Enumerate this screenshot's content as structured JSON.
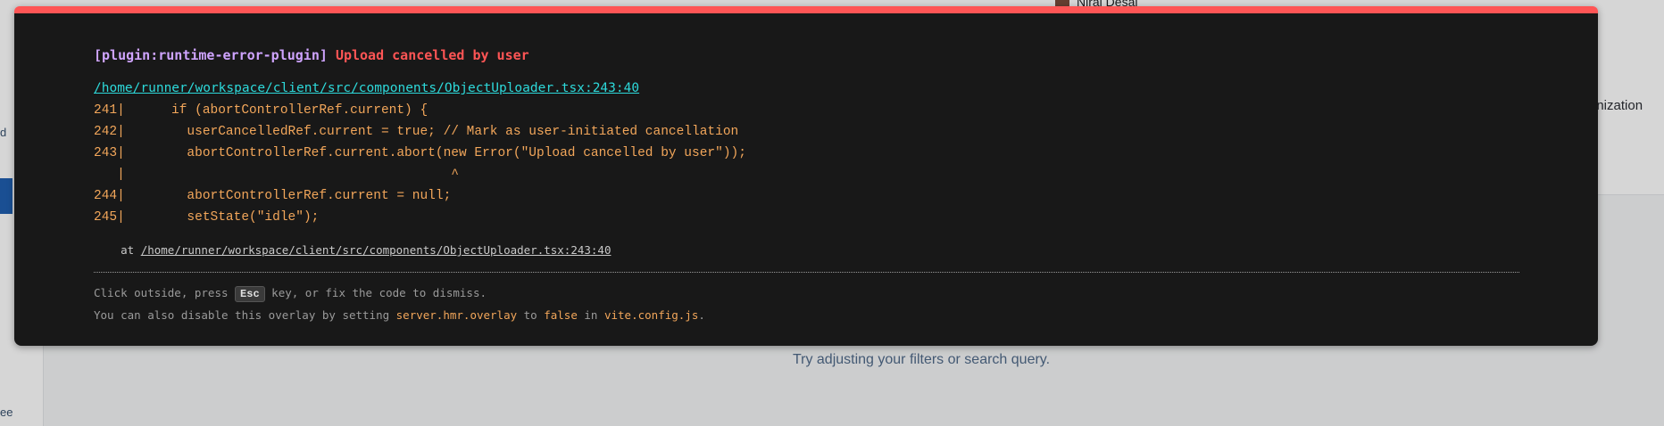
{
  "background_app": {
    "user_name": "Niraj Desai",
    "right_fragment": "anization",
    "sidebar_fragment_1": "d",
    "sidebar_fragment_2": "ee",
    "empty_state_text": "Try adjusting your filters or search query."
  },
  "overlay": {
    "plugin": "[plugin:runtime-error-plugin]",
    "message": "Upload cancelled by user",
    "file": "/home/runner/workspace/client/src/components/ObjectUploader.tsx:243:40",
    "code_lines": [
      "241|      if (abortControllerRef.current) {",
      "242|        userCancelledRef.current = true; // Mark as user-initiated cancellation",
      "243|        abortControllerRef.current.abort(new Error(\"Upload cancelled by user\"));",
      "   |                                          ^",
      "244|        abortControllerRef.current = null;",
      "245|        setState(\"idle\");"
    ],
    "stack_prefix": "    at ",
    "stack_file": "/home/runner/workspace/client/src/components/ObjectUploader.tsx:243:40",
    "tip1": {
      "before": "Click outside, press ",
      "key": "Esc",
      "after": " key, or fix the code to dismiss."
    },
    "tip2": {
      "before": "You can also disable this overlay by setting ",
      "setting": "server.hmr.overlay",
      "middle": " to ",
      "value": "false",
      "in_text": " in ",
      "config_file": "vite.config.js",
      "end": "."
    }
  },
  "colors": {
    "accent_red": "#ff5555",
    "plugin_purple": "#cfa4ff",
    "link_cyan": "#2dd9da",
    "code_orange": "#f2a65a",
    "overlay_bg": "#181818"
  }
}
